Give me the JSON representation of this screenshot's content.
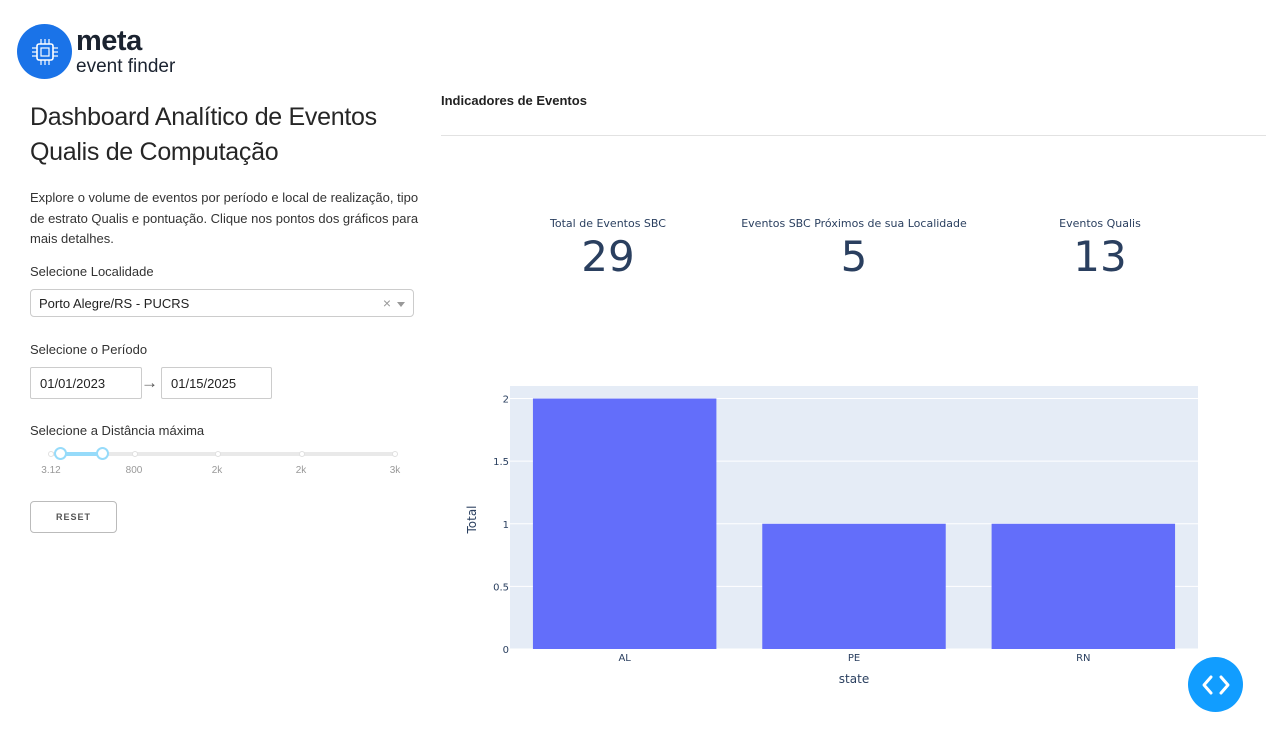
{
  "brand": {
    "name": "meta",
    "subtitle": "event finder",
    "icon": "chip-icon"
  },
  "sidebar": {
    "title": "Dashboard Analítico de Eventos Qualis de Computação",
    "description": "Explore o volume de eventos por período e local de realização, tipo de estrato Qualis e pontuação. Clique nos pontos dos gráficos para mais detalhes.",
    "location": {
      "label": "Selecione Localidade",
      "value": "Porto Alegre/RS - PUCRS",
      "clear_icon": "close-icon",
      "dropdown_icon": "chevron-down-icon"
    },
    "period": {
      "label": "Selecione o Período",
      "start": "01/01/2023",
      "end": "01/15/2025",
      "arrow": "→"
    },
    "distance": {
      "label": "Selecione a Distância máxima",
      "marks": [
        "3.12",
        "800",
        "2k",
        "2k",
        "3k"
      ],
      "selected_range_fraction": [
        0.03,
        0.152
      ]
    },
    "reset_label": "RESET"
  },
  "indicators": {
    "title": "Indicadores de Eventos",
    "kpis": [
      {
        "label": "Total de Eventos SBC",
        "value": "29"
      },
      {
        "label": "Eventos SBC Próximos de sua Localidade",
        "value": "5"
      },
      {
        "label": "Eventos Qualis",
        "value": "13"
      }
    ]
  },
  "chart_data": {
    "type": "bar",
    "categories": [
      "AL",
      "PE",
      "RN"
    ],
    "values": [
      2,
      1,
      1
    ],
    "xlabel": "state",
    "ylabel": "Total",
    "ylim": [
      0,
      2.1
    ],
    "yticks": [
      "0",
      "0.5",
      "1",
      "1.5",
      "2"
    ],
    "grid": true,
    "colors": {
      "bar": "#636efa",
      "plot_bg": "#e5ecf6"
    }
  },
  "fab": {
    "icon": "code-brackets-icon"
  },
  "colors": {
    "accent": "#1a73e8",
    "slider": "#96dbfa",
    "fab": "#119dff"
  }
}
